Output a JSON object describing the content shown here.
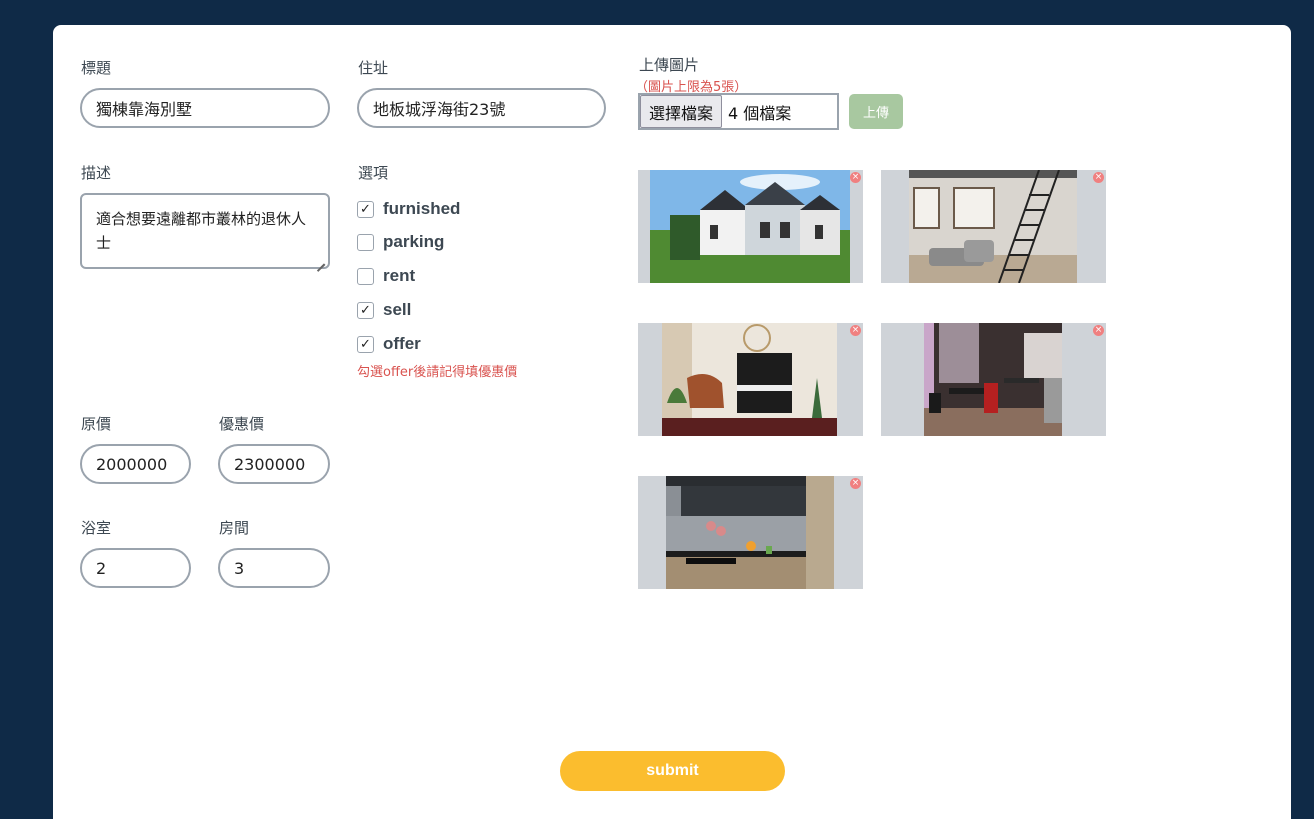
{
  "form": {
    "title": {
      "label": "標題",
      "value": "獨棟靠海別墅"
    },
    "address": {
      "label": "住址",
      "value": "地板城浮海街23號"
    },
    "description": {
      "label": "描述",
      "value": "適合想要遠離都市叢林的退休人士"
    },
    "options": {
      "label": "選項",
      "items": [
        {
          "label": "furnished",
          "checked": true
        },
        {
          "label": "parking",
          "checked": false
        },
        {
          "label": "rent",
          "checked": false
        },
        {
          "label": "sell",
          "checked": true
        },
        {
          "label": "offer",
          "checked": true
        }
      ],
      "note": "勾選offer後請記得填優惠價"
    },
    "original_price": {
      "label": "原價",
      "value": "2000000"
    },
    "discount_price": {
      "label": "優惠價",
      "value": "2300000"
    },
    "bathrooms": {
      "label": "浴室",
      "value": "2"
    },
    "rooms": {
      "label": "房間",
      "value": "3"
    },
    "upload": {
      "label": "上傳圖片",
      "note": "（圖片上限為5張）",
      "choose_button": "選擇檔案",
      "file_count_text": "4 個檔案",
      "upload_button": "上傳"
    },
    "images": [
      {
        "alt": "house-exterior-image"
      },
      {
        "alt": "loft-living-room-image"
      },
      {
        "alt": "piano-room-image"
      },
      {
        "alt": "dining-room-image"
      },
      {
        "alt": "kitchen-image"
      }
    ],
    "submit_label": "submit"
  },
  "icons": {
    "checkmark": "check-icon",
    "remove": "close-icon"
  },
  "colors": {
    "background": "#0f2a47",
    "submit": "#fbbd2e",
    "upload_button": "#a8c8a0",
    "note": "#d9534f",
    "remove": "#f08080"
  }
}
